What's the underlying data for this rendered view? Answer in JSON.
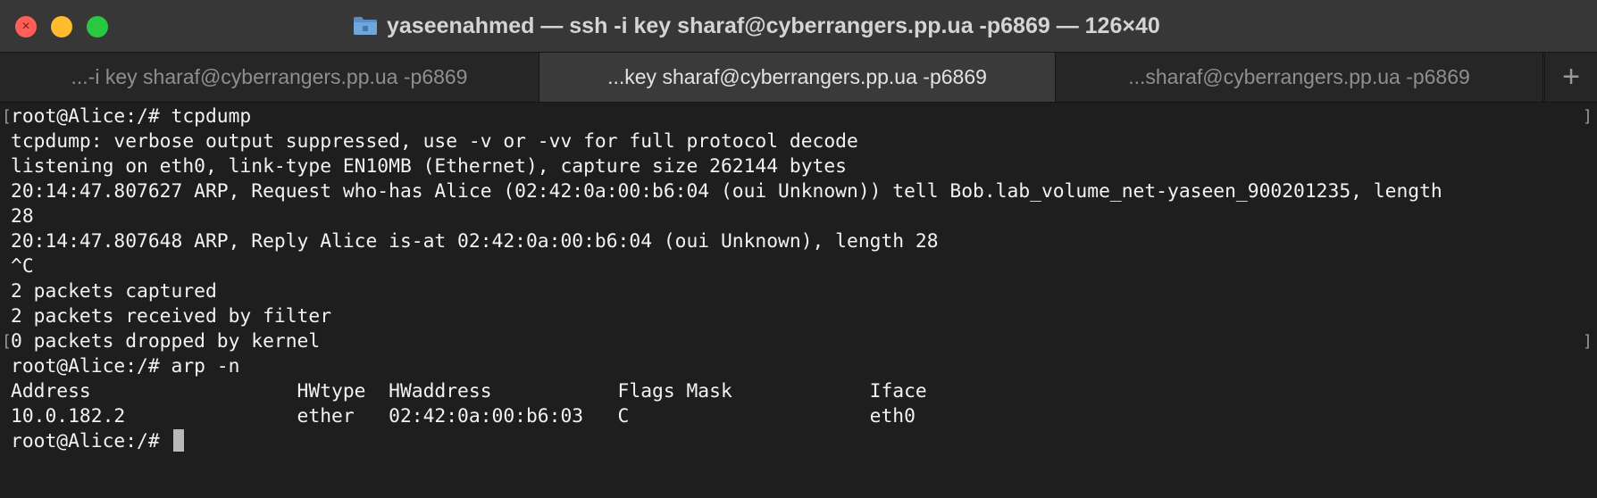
{
  "window": {
    "title": "yaseenahmed — ssh -i key sharaf@cyberrangers.pp.ua -p6869 — 126×40",
    "folder_icon": "folder-icon",
    "colors": {
      "close": "#ff5f57",
      "minimize": "#febc2e",
      "maximize": "#28c840"
    }
  },
  "tabs": [
    {
      "label": "...-i key sharaf@cyberrangers.pp.ua -p6869",
      "active": false
    },
    {
      "label": "...key sharaf@cyberrangers.pp.ua -p6869",
      "active": true
    },
    {
      "label": "...sharaf@cyberrangers.pp.ua -p6869",
      "active": false
    }
  ],
  "new_tab_label": "+",
  "terminal": {
    "lines": [
      "root@Alice:/# tcpdump",
      "tcpdump: verbose output suppressed, use -v or -vv for full protocol decode",
      "listening on eth0, link-type EN10MB (Ethernet), capture size 262144 bytes",
      "20:14:47.807627 ARP, Request who-has Alice (02:42:0a:00:b6:04 (oui Unknown)) tell Bob.lab_volume_net-yaseen_900201235, length",
      "28",
      "20:14:47.807648 ARP, Reply Alice is-at 02:42:0a:00:b6:04 (oui Unknown), length 28",
      "^C",
      "2 packets captured",
      "2 packets received by filter",
      "0 packets dropped by kernel",
      "root@Alice:/# arp -n",
      "Address                  HWtype  HWaddress           Flags Mask            Iface",
      "10.0.182.2               ether   02:42:0a:00:b6:03   C                     eth0",
      "root@Alice:/# "
    ],
    "mark_left": "[",
    "mark_right": "]"
  }
}
